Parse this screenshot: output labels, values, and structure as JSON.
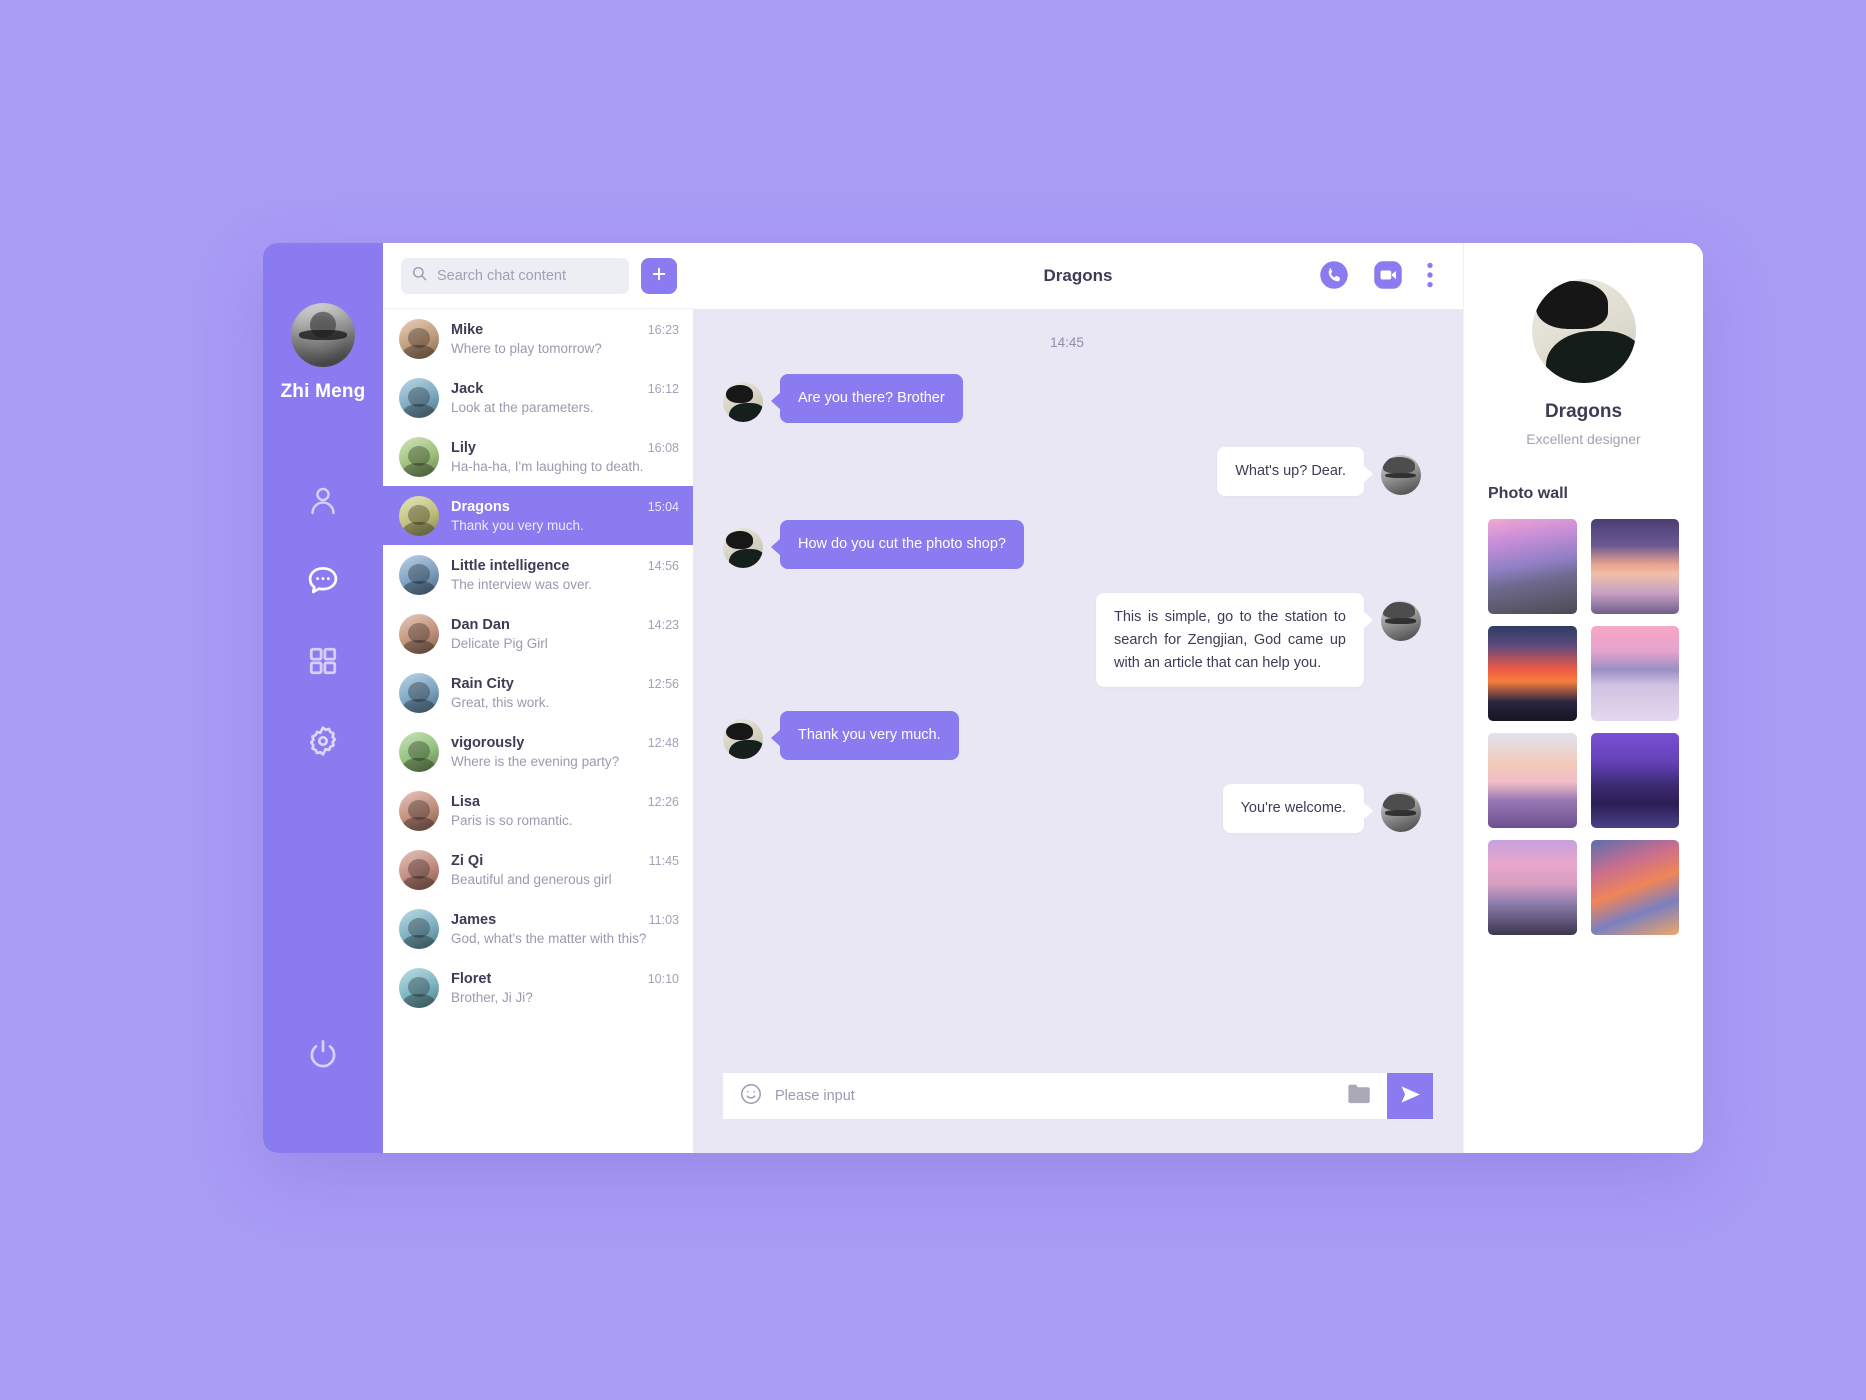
{
  "theme": {
    "page_background": "#a99cf5",
    "accent": "#8b7bf0",
    "chat_background": "#e9e7f4",
    "panel_background": "#ffffff",
    "text_dark": "#3c3c55",
    "text_muted": "#9a9aae"
  },
  "nav": {
    "username": "Zhi Meng",
    "avatar_name": "user-avatar",
    "items": [
      {
        "icon": "person-icon",
        "label": "Contacts",
        "active": false
      },
      {
        "icon": "chat-bubble-icon",
        "label": "Chats",
        "active": true
      },
      {
        "icon": "grid-apps-icon",
        "label": "Apps",
        "active": false
      },
      {
        "icon": "gear-icon",
        "label": "Settings",
        "active": false
      }
    ],
    "power": {
      "icon": "power-icon",
      "label": "Log out"
    }
  },
  "list": {
    "search": {
      "placeholder": "Search chat content",
      "value": "",
      "icon": "search-icon"
    },
    "add_button": {
      "icon": "plus-icon",
      "label": "+"
    },
    "rows": [
      {
        "name": "Mike",
        "snippet": "Where to play tomorrow?",
        "time": "16:23",
        "selected": false,
        "avatar_hue": 28
      },
      {
        "name": "Jack",
        "snippet": "Look at the parameters.",
        "time": "16:12",
        "selected": false,
        "avatar_hue": 200
      },
      {
        "name": "Lily",
        "snippet": "Ha-ha-ha, I'm laughing to death.",
        "time": "16:08",
        "selected": false,
        "avatar_hue": 90
      },
      {
        "name": "Dragons",
        "snippet": "Thank you very much.",
        "time": "15:04",
        "selected": true,
        "avatar_hue": 60
      },
      {
        "name": "Little intelligence",
        "snippet": "The interview was over.",
        "time": "14:56",
        "selected": false,
        "avatar_hue": 210
      },
      {
        "name": "Dan Dan",
        "snippet": "Delicate Pig Girl",
        "time": "14:23",
        "selected": false,
        "avatar_hue": 20
      },
      {
        "name": "Rain City",
        "snippet": "Great, this work.",
        "time": "12:56",
        "selected": false,
        "avatar_hue": 205
      },
      {
        "name": "vigorously",
        "snippet": "Where is the evening party?",
        "time": "12:48",
        "selected": false,
        "avatar_hue": 100
      },
      {
        "name": "Lisa",
        "snippet": "Paris is so romantic.",
        "time": "12:26",
        "selected": false,
        "avatar_hue": 15
      },
      {
        "name": "Zi Qi",
        "snippet": "Beautiful and generous girl",
        "time": "11:45",
        "selected": false,
        "avatar_hue": 12
      },
      {
        "name": "James",
        "snippet": "God, what's the matter with this?",
        "time": "11:03",
        "selected": false,
        "avatar_hue": 195
      },
      {
        "name": "Floret",
        "snippet": "Brother, Ji Ji?",
        "time": "10:10",
        "selected": false,
        "avatar_hue": 190
      }
    ]
  },
  "conversation": {
    "title": "Dragons",
    "actions": [
      {
        "icon": "phone-call-icon",
        "label": "Voice call"
      },
      {
        "icon": "video-camera-icon",
        "label": "Video call"
      },
      {
        "icon": "more-vertical-icon",
        "label": "More options"
      }
    ],
    "timestamp": "14:45",
    "messages": [
      {
        "direction": "in",
        "text": "Are you there? Brother",
        "avatar": "dragons-avatar"
      },
      {
        "direction": "out",
        "text": "What's up? Dear.",
        "avatar": "zhi-meng-avatar"
      },
      {
        "direction": "in",
        "text": "How do you cut the photo shop?",
        "avatar": "dragons-avatar"
      },
      {
        "direction": "out",
        "text": "This is simple, go to the station to search for Zengjian, God came up with an article that can help you.",
        "avatar": "zhi-meng-avatar",
        "wide": true
      },
      {
        "direction": "in",
        "text": "Thank you very much.",
        "avatar": "dragons-avatar"
      },
      {
        "direction": "out",
        "text": "You're welcome.",
        "avatar": "zhi-meng-avatar"
      }
    ],
    "composer": {
      "emoji_icon": "smiley-face-icon",
      "placeholder": "Please input",
      "value": "",
      "attach_icon": "folder-icon",
      "send_icon": "send-paper-plane-icon",
      "send_label": "Send"
    }
  },
  "profile": {
    "avatar_name": "dragons-profile-avatar",
    "name": "Dragons",
    "role": "Excellent designer",
    "photo_wall_title": "Photo wall",
    "photos": [
      {
        "alt": "pink sunset over wooden pier",
        "gradient": "linear-gradient(170deg,#f3a6d2 0%,#c98fd8 22%,#8f7fc4 48%,#6e6a8e 64%,#4e4a52 100%)"
      },
      {
        "alt": "lone tree on still lake at dusk",
        "gradient": "linear-gradient(180deg,#4b3d74 0%,#6b5a92 28%,#e8a38f 48%,#f0bfa8 58%,#c7a0c4 78%,#6f5e8c 100%)"
      },
      {
        "alt": "red sunset over dark mountain",
        "gradient": "linear-gradient(180deg,#2d3d63 0%,#5b4a7d 20%,#ef5a44 46%,#f97e3e 58%,#2a2640 80%,#151522 100%)"
      },
      {
        "alt": "snowy mountain range above clouds",
        "gradient": "linear-gradient(180deg,#f6a7c6 0%,#e7a3cd 26%,#9a8fc4 46%,#cfc2e2 62%,#e4d8ef 100%)"
      },
      {
        "alt": "lavender field at sunrise",
        "gradient": "linear-gradient(180deg,#dfe3f0 0%,#f3cbb9 32%,#f0bcc6 52%,#9b7ab4 70%,#6b4f90 100%)"
      },
      {
        "alt": "purple tropical waterfront at night",
        "gradient": "linear-gradient(180deg,#7a4fd4 0%,#6442b8 30%,#3c2a72 55%,#2a1f56 75%,#4b3f86 100%)"
      },
      {
        "alt": "wooden boat on pink calm sea",
        "gradient": "linear-gradient(180deg,#c9a0e0 0%,#e8a7c9 26%,#d79ec2 46%,#8e7fae 66%,#3c3550 100%)"
      },
      {
        "alt": "fiery orange clouds at sunset",
        "gradient": "linear-gradient(160deg,#5b6fae 0%,#c96e8e 28%,#ef8558 50%,#7b7fc0 72%,#f0a766 100%)"
      }
    ]
  }
}
